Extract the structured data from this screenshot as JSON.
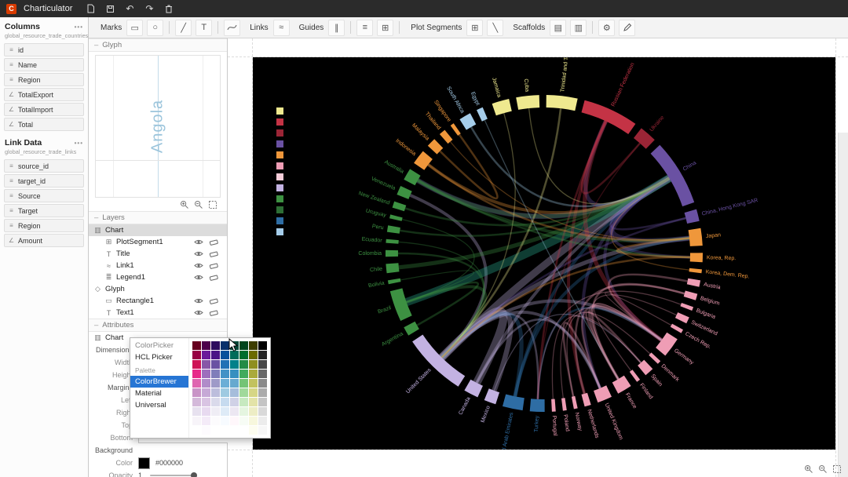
{
  "app": {
    "title": "Charticulator"
  },
  "ui": {
    "collapse_glyph": "–",
    "menu_glyph": "•••"
  },
  "topbar": {
    "icons": [
      {
        "name": "new-file-icon",
        "svg": "file"
      },
      {
        "name": "save-icon",
        "svg": "save"
      },
      {
        "name": "undo-icon",
        "glyph": "↶"
      },
      {
        "name": "redo-icon",
        "glyph": "↷"
      },
      {
        "name": "delete-icon",
        "svg": "trash"
      }
    ]
  },
  "toolbar": {
    "items": [
      {
        "type": "label",
        "text": "Marks"
      },
      {
        "type": "icon",
        "name": "rectangle-mark-icon",
        "glyph": "▭"
      },
      {
        "type": "icon",
        "name": "symbol-mark-icon",
        "glyph": "○"
      },
      {
        "type": "sep"
      },
      {
        "type": "icon",
        "name": "line-mark-icon",
        "glyph": "╱"
      },
      {
        "type": "icon",
        "name": "text-mark-icon",
        "glyph": "T"
      },
      {
        "type": "sep"
      },
      {
        "type": "icon",
        "name": "curve-mark-icon",
        "svg": "curve"
      },
      {
        "type": "label",
        "text": "Links"
      },
      {
        "type": "icon",
        "name": "links-icon",
        "glyph": "≈"
      },
      {
        "type": "label",
        "text": "Guides"
      },
      {
        "type": "icon",
        "name": "guide-icon",
        "glyph": "∥"
      },
      {
        "type": "sep"
      },
      {
        "type": "icon",
        "name": "guide-coordinator-icon",
        "glyph": "≡"
      },
      {
        "type": "icon",
        "name": "guide-grid-icon",
        "glyph": "⊞"
      },
      {
        "type": "sep"
      },
      {
        "type": "label",
        "text": "Plot Segments"
      },
      {
        "type": "icon",
        "name": "region-plot-segment-icon",
        "glyph": "⊞"
      },
      {
        "type": "icon",
        "name": "line-plot-segment-icon",
        "glyph": "╲"
      },
      {
        "type": "label",
        "text": "Scaffolds"
      },
      {
        "type": "icon",
        "name": "scaffold-horizontal-icon",
        "glyph": "▤"
      },
      {
        "type": "icon",
        "name": "scaffold-vertical-icon",
        "glyph": "▥"
      },
      {
        "type": "sep"
      },
      {
        "type": "icon",
        "name": "settings-gear-icon",
        "glyph": "⚙"
      },
      {
        "type": "icon",
        "name": "edit-pencil-icon",
        "svg": "pencil"
      }
    ]
  },
  "columns_panel": {
    "title": "Columns",
    "dataset": "global_resource_trade_countries",
    "fields": [
      {
        "name": "id",
        "type": "text"
      },
      {
        "name": "Name",
        "type": "text"
      },
      {
        "name": "Region",
        "type": "text"
      },
      {
        "name": "TotalExport",
        "type": "number"
      },
      {
        "name": "TotalImport",
        "type": "number"
      },
      {
        "name": "Total",
        "type": "number"
      }
    ]
  },
  "link_panel": {
    "title": "Link Data",
    "dataset": "global_resource_trade_links",
    "fields": [
      {
        "name": "source_id",
        "type": "text"
      },
      {
        "name": "target_id",
        "type": "text"
      },
      {
        "name": "Source",
        "type": "text"
      },
      {
        "name": "Target",
        "type": "text"
      },
      {
        "name": "Region",
        "type": "text"
      },
      {
        "name": "Amount",
        "type": "number"
      }
    ]
  },
  "glyph_panel": {
    "header": "Glyph",
    "glyph_text": "Angola"
  },
  "layers_panel": {
    "header": "Layers",
    "items": [
      {
        "label": "Chart",
        "depth": 0,
        "icon": "chart",
        "selected": true,
        "controls": false
      },
      {
        "label": "PlotSegment1",
        "depth": 1,
        "icon": "plot",
        "controls": true
      },
      {
        "label": "Title",
        "depth": 1,
        "icon": "text",
        "controls": true
      },
      {
        "label": "Link1",
        "depth": 1,
        "icon": "link",
        "controls": true
      },
      {
        "label": "Legend1",
        "depth": 1,
        "icon": "legend",
        "controls": true
      },
      {
        "label": "Glyph",
        "depth": 0,
        "icon": "glyph",
        "controls": false
      },
      {
        "label": "Rectangle1",
        "depth": 1,
        "icon": "rect",
        "controls": true
      },
      {
        "label": "Text1",
        "depth": 1,
        "icon": "text",
        "controls": true
      }
    ]
  },
  "attributes_panel": {
    "header": "Attributes",
    "chart_label": "Chart",
    "rows": [
      {
        "label": "Dimensions",
        "kind": "group"
      },
      {
        "label": "Width",
        "kind": "input",
        "value": ""
      },
      {
        "label": "Height",
        "kind": "input",
        "value": ""
      },
      {
        "label": "Margins",
        "kind": "group"
      },
      {
        "label": "Left",
        "kind": "input",
        "value": ""
      },
      {
        "label": "Right",
        "kind": "input",
        "value": ""
      },
      {
        "label": "Top",
        "kind": "input",
        "value": ""
      },
      {
        "label": "Bottom",
        "kind": "input",
        "value": ""
      },
      {
        "label": "Background",
        "kind": "group"
      },
      {
        "label": "Color",
        "kind": "color",
        "value": "#000000"
      },
      {
        "label": "Opacity",
        "kind": "slider",
        "value": "1"
      }
    ]
  },
  "color_picker": {
    "items": [
      {
        "label": "ColorPicker",
        "kind": "dim"
      },
      {
        "label": "HCL Picker",
        "kind": "item"
      },
      {
        "label": "Palette",
        "kind": "header"
      },
      {
        "label": "ColorBrewer",
        "kind": "selected"
      },
      {
        "label": "Material",
        "kind": "item"
      },
      {
        "label": "Universal",
        "kind": "item"
      }
    ],
    "grid": [
      [
        "#67001f",
        "#4d004b",
        "#2d0b5e",
        "#08306b",
        "#014636",
        "#00441b",
        "#3e3e00",
        "#000000"
      ],
      [
        "#980043",
        "#6a1b9a",
        "#4a1486",
        "#08519c",
        "#016c59",
        "#006d2c",
        "#6b6b00",
        "#252525"
      ],
      [
        "#ce1256",
        "#8856a7",
        "#6a51a3",
        "#2171b5",
        "#02818a",
        "#238b45",
        "#8f8f1f",
        "#474747"
      ],
      [
        "#e7298a",
        "#9e6ebd",
        "#807dba",
        "#4292c6",
        "#3690c0",
        "#41ab5d",
        "#aaaa3c",
        "#696969"
      ],
      [
        "#df65b0",
        "#b08cc9",
        "#9e9ac8",
        "#6baed6",
        "#67a9cf",
        "#74c476",
        "#c2c25e",
        "#8a8a8a"
      ],
      [
        "#c994c7",
        "#c6a9d6",
        "#bcbddc",
        "#9ecae1",
        "#a6bddb",
        "#a1d99b",
        "#d6d685",
        "#ababab"
      ],
      [
        "#d4b9da",
        "#d9c4e3",
        "#dadaeb",
        "#c6dbef",
        "#d0d1e6",
        "#c7e9c0",
        "#e3e3a8",
        "#c4c4c4"
      ],
      [
        "#e7e1ef",
        "#e8daf0",
        "#efedf5",
        "#deebf7",
        "#ece7f2",
        "#e5f5e0",
        "#ededc5",
        "#d9d9d9"
      ],
      [
        "#f7f4f9",
        "#f4ebf8",
        "#fcfbfd",
        "#f7fbff",
        "#fff7fb",
        "#f7fcf5",
        "#f7f7dd",
        "#ececec"
      ],
      [
        "#ffffff",
        "#fdfbfe",
        "#ffffff",
        "#ffffff",
        "#ffffff",
        "#ffffff",
        "#fdfdf0",
        "#f7f7f7"
      ]
    ]
  },
  "chart_data": {
    "type": "chord",
    "background": "#000000",
    "groups": {
      "yellow": "#efe98f",
      "red": "#c43345",
      "darkred": "#9b2536",
      "purple": "#6a51a3",
      "orange": "#ef973b",
      "pink": "#ef9db5",
      "blue": "#2e6da4",
      "lavender": "#c3b2e2",
      "green": "#3d9142",
      "lightblue": "#a5cdea"
    },
    "legend": [
      "#efe98f",
      "#c43345",
      "#9b2536",
      "#6a51a3",
      "#ef973b",
      "#ef9db5",
      "#f6cdd9",
      "#c3b2e2",
      "#3d9142",
      "#2d6e35",
      "#2e6da4",
      "#a5cdea"
    ],
    "countries": [
      {
        "n": "Trinidad and Tobago",
        "g": "yellow",
        "a": [
          0,
          13
        ]
      },
      {
        "n": "Russian Federation",
        "g": "red",
        "a": [
          14,
          36
        ]
      },
      {
        "n": "Ukraine",
        "g": "darkred",
        "a": [
          37,
          45
        ]
      },
      {
        "n": "China",
        "g": "purple",
        "a": [
          46,
          72
        ]
      },
      {
        "n": "China, Hong Kong SAR",
        "g": "purple",
        "a": [
          73,
          79
        ]
      },
      {
        "n": "Japan",
        "g": "orange",
        "a": [
          80,
          88
        ]
      },
      {
        "n": "Korea, Rep.",
        "g": "orange",
        "a": [
          89,
          94
        ]
      },
      {
        "n": "Korea, Dem. Rep.",
        "g": "orange",
        "a": [
          95,
          98
        ]
      },
      {
        "n": "Austria",
        "g": "pink",
        "a": [
          99,
          103
        ]
      },
      {
        "n": "Belgium",
        "g": "pink",
        "a": [
          104,
          108
        ]
      },
      {
        "n": "Bulgaria",
        "g": "pink",
        "a": [
          109,
          112
        ]
      },
      {
        "n": "Switzerland",
        "g": "pink",
        "a": [
          113,
          117
        ]
      },
      {
        "n": "Czech Rep.",
        "g": "pink",
        "a": [
          118,
          121
        ]
      },
      {
        "n": "Germany",
        "g": "pink",
        "a": [
          122,
          131
        ]
      },
      {
        "n": "Denmark",
        "g": "pink",
        "a": [
          132,
          135
        ]
      },
      {
        "n": "Spain",
        "g": "pink",
        "a": [
          136,
          141
        ]
      },
      {
        "n": "Finland",
        "g": "pink",
        "a": [
          142,
          145
        ]
      },
      {
        "n": "France",
        "g": "pink",
        "a": [
          146,
          153
        ]
      },
      {
        "n": "United Kingdom",
        "g": "pink",
        "a": [
          154,
          161
        ]
      },
      {
        "n": "Netherlands",
        "g": "pink",
        "a": [
          162,
          166
        ]
      },
      {
        "n": "Norway",
        "g": "pink",
        "a": [
          167,
          170
        ]
      },
      {
        "n": "Poland",
        "g": "pink",
        "a": [
          171,
          174
        ]
      },
      {
        "n": "Portugal",
        "g": "pink",
        "a": [
          175,
          178
        ]
      },
      {
        "n": "Turkey",
        "g": "blue",
        "a": [
          179,
          186
        ]
      },
      {
        "n": "United Arab Emirates",
        "g": "blue",
        "a": [
          187,
          196
        ]
      },
      {
        "n": "Mexico",
        "g": "lavender",
        "a": [
          197,
          203
        ]
      },
      {
        "n": "Canada",
        "g": "lavender",
        "a": [
          204,
          211
        ]
      },
      {
        "n": "United States",
        "g": "lavender",
        "a": [
          212,
          237
        ]
      },
      {
        "n": "Argentina",
        "g": "green",
        "a": [
          238,
          243
        ]
      },
      {
        "n": "Brazil",
        "g": "green",
        "a": [
          244,
          257
        ]
      },
      {
        "n": "Bolivia",
        "g": "green",
        "a": [
          258,
          261
        ]
      },
      {
        "n": "Chile",
        "g": "green",
        "a": [
          262,
          267
        ]
      },
      {
        "n": "Colombia",
        "g": "green",
        "a": [
          268,
          272
        ]
      },
      {
        "n": "Ecuador",
        "g": "green",
        "a": [
          273,
          276
        ]
      },
      {
        "n": "Peru",
        "g": "green",
        "a": [
          277,
          281
        ]
      },
      {
        "n": "Uruguay",
        "g": "green",
        "a": [
          282,
          285
        ]
      },
      {
        "n": "New Zealand",
        "g": "green",
        "a": [
          286,
          290
        ]
      },
      {
        "n": "Venezuela",
        "g": "green",
        "a": [
          291,
          296
        ]
      },
      {
        "n": "Australia",
        "g": "green",
        "a": [
          297,
          303
        ]
      },
      {
        "n": "Indonesia",
        "g": "orange",
        "a": [
          304,
          311
        ]
      },
      {
        "n": "Malaysia",
        "g": "orange",
        "a": [
          312,
          317
        ]
      },
      {
        "n": "Thailand",
        "g": "orange",
        "a": [
          318,
          322
        ]
      },
      {
        "n": "Singapore",
        "g": "orange",
        "a": [
          323,
          326
        ]
      },
      {
        "n": "South Africa",
        "g": "lightblue",
        "a": [
          327,
          333
        ]
      },
      {
        "n": "Egypt",
        "g": "lightblue",
        "a": [
          334,
          338
        ]
      },
      {
        "n": "Jamaica",
        "g": "yellow",
        "a": [
          340,
          348
        ]
      },
      {
        "n": "Cuba",
        "g": "yellow",
        "a": [
          349,
          359
        ]
      }
    ],
    "links": [
      [
        27,
        3,
        7
      ],
      [
        27,
        26,
        8
      ],
      [
        27,
        25,
        5
      ],
      [
        27,
        5,
        4
      ],
      [
        27,
        13,
        3
      ],
      [
        27,
        18,
        3
      ],
      [
        27,
        37,
        3
      ],
      [
        27,
        23,
        2
      ],
      [
        29,
        3,
        8,
        "#2fb89a"
      ],
      [
        29,
        27,
        3
      ],
      [
        29,
        28,
        2
      ],
      [
        3,
        5,
        5
      ],
      [
        3,
        6,
        3
      ],
      [
        3,
        38,
        5
      ],
      [
        3,
        1,
        4
      ],
      [
        3,
        13,
        3
      ],
      [
        3,
        18,
        3
      ],
      [
        1,
        13,
        4
      ],
      [
        1,
        2,
        2
      ],
      [
        1,
        19,
        3
      ],
      [
        1,
        23,
        2
      ],
      [
        13,
        17,
        3
      ],
      [
        13,
        18,
        2
      ],
      [
        13,
        8,
        2
      ],
      [
        17,
        15,
        2
      ],
      [
        18,
        20,
        2
      ],
      [
        19,
        9,
        2
      ],
      [
        23,
        13,
        2
      ],
      [
        24,
        5,
        3
      ],
      [
        24,
        3,
        3
      ],
      [
        24,
        27,
        4
      ],
      [
        31,
        3,
        4
      ],
      [
        34,
        3,
        2
      ],
      [
        38,
        5,
        3
      ],
      [
        38,
        6,
        2
      ],
      [
        38,
        3,
        4
      ],
      [
        39,
        5,
        2
      ],
      [
        39,
        3,
        3
      ],
      [
        40,
        42,
        2
      ],
      [
        41,
        5,
        1
      ],
      [
        43,
        3,
        2
      ],
      [
        26,
        18,
        2
      ],
      [
        26,
        3,
        3
      ],
      [
        25,
        15,
        1
      ],
      [
        32,
        27,
        2
      ],
      [
        33,
        27,
        1
      ],
      [
        0,
        27,
        2
      ],
      [
        45,
        27,
        1
      ],
      [
        46,
        3,
        1
      ],
      [
        2,
        23,
        1
      ],
      [
        21,
        13,
        1
      ],
      [
        12,
        13,
        1
      ],
      [
        11,
        17,
        1
      ],
      [
        14,
        20,
        1
      ],
      [
        10,
        23,
        1
      ],
      [
        22,
        15,
        1
      ],
      [
        7,
        3,
        1
      ],
      [
        4,
        3,
        2
      ],
      [
        4,
        27,
        2
      ],
      [
        5,
        6,
        2
      ],
      [
        30,
        29,
        1
      ],
      [
        36,
        3,
        2
      ],
      [
        35,
        29,
        1
      ],
      [
        44,
        17,
        1
      ],
      [
        6,
        27,
        2
      ],
      [
        16,
        13,
        1
      ],
      [
        9,
        17,
        2
      ]
    ]
  }
}
